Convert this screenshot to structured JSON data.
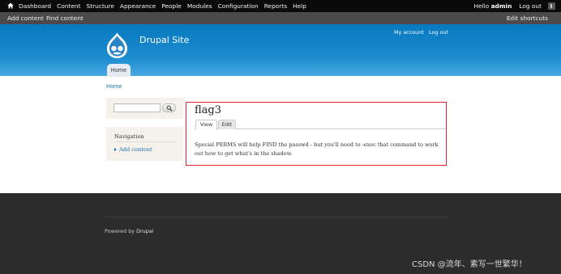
{
  "toolbar": {
    "menu": [
      "Dashboard",
      "Content",
      "Structure",
      "Appearance",
      "People",
      "Modules",
      "Configuration",
      "Reports",
      "Help"
    ],
    "greeting_prefix": "Hello",
    "username": "admin",
    "logout_label": "Log out"
  },
  "shortcuts": {
    "add_content": "Add content",
    "find_content": "Find content",
    "edit_shortcuts": "Edit shortcuts"
  },
  "header": {
    "site_name": "Drupal Site",
    "my_account": "My account",
    "log_out": "Log out",
    "main_tab_home": "Home"
  },
  "breadcrumb": "Home",
  "sidebar": {
    "search_value": "",
    "nav_title": "Navigation",
    "nav_items": [
      "Add content"
    ]
  },
  "node": {
    "title": "flag3",
    "tabs": [
      "View",
      "Edit"
    ],
    "body": "Special PERMS will help FIND the passwd - but you'll need to -exec that command to work out how to get what's in the shadow."
  },
  "footer": {
    "powered_prefix": "Powered by",
    "powered_link": "Drupal"
  },
  "watermark": "CSDN @流年、素写一世繁华！",
  "colors": {
    "header_blue": "#1d8ccf",
    "link_blue": "#1a6fb0",
    "highlight_red": "#e0242c",
    "footer_dark": "#2c2c2c"
  }
}
